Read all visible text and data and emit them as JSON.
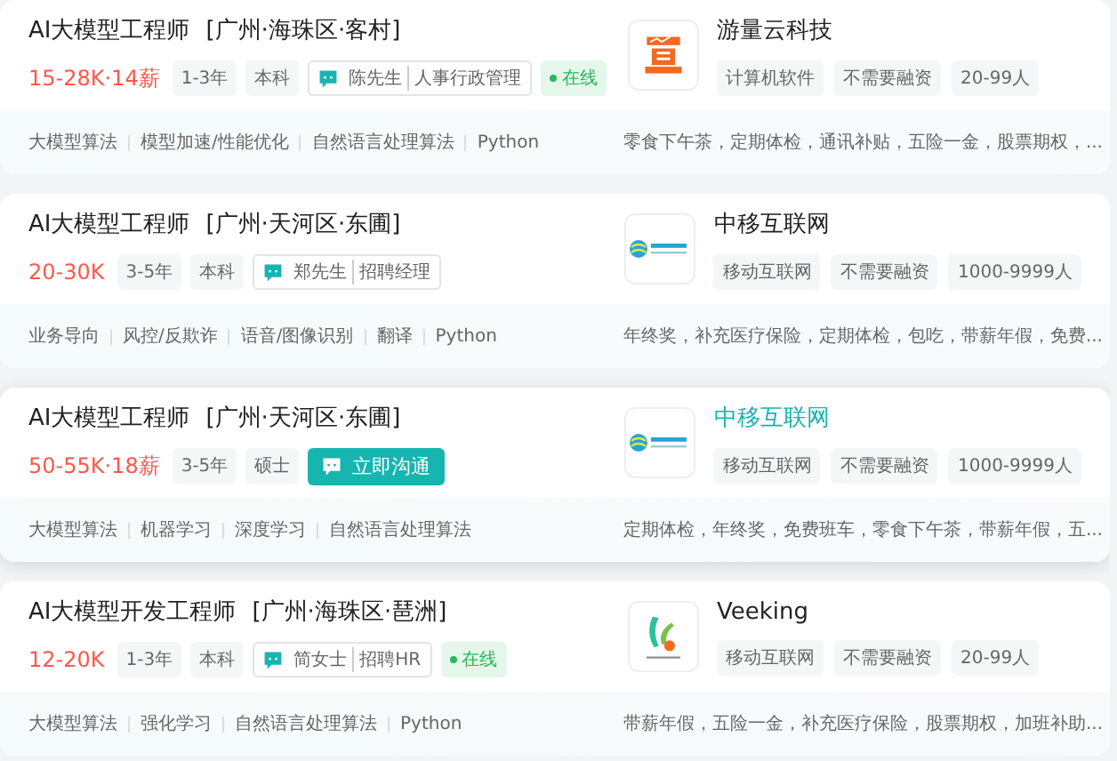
{
  "jobs": [
    {
      "title": "AI大模型工程师",
      "location": "[广州·海珠区·客村]",
      "salary": "15-28K·14薪",
      "tags": [
        "1-3年",
        "本科"
      ],
      "recruiter": {
        "kind": "contact",
        "name": "陈先生",
        "role": "人事行政管理"
      },
      "online": true,
      "online_label": "在线",
      "hovered": false,
      "company": {
        "kind": "bars",
        "name": "游量云科技",
        "tags": [
          "计算机软件",
          "不需要融资",
          "20-99人"
        ]
      },
      "skills": [
        "大模型算法",
        "模型加速/性能优化",
        "自然语言处理算法",
        "Python"
      ],
      "benefits": "零食下午茶，定期体检，通讯补贴，五险一金，股票期权，..."
    },
    {
      "title": "AI大模型工程师",
      "location": "[广州·天河区·东圃]",
      "salary": "20-30K",
      "tags": [
        "3-5年",
        "本科"
      ],
      "recruiter": {
        "kind": "contact",
        "name": "郑先生",
        "role": "招聘经理"
      },
      "online": false,
      "hovered": false,
      "company": {
        "kind": "globe",
        "name": "中移互联网",
        "tags": [
          "移动互联网",
          "不需要融资",
          "1000-9999人"
        ]
      },
      "skills": [
        "业务导向",
        "风控/反欺诈",
        "语音/图像识别",
        "翻译",
        "Python"
      ],
      "benefits": "年终奖，补充医疗保险，定期体检，包吃，带薪年假，免费..."
    },
    {
      "title": "AI大模型工程师",
      "location": "[广州·天河区·东圃]",
      "salary": "50-55K·18薪",
      "tags": [
        "3-5年",
        "硕士"
      ],
      "recruiter": {
        "kind": "chat",
        "label": "立即沟通"
      },
      "online": false,
      "hovered": true,
      "company": {
        "kind": "globe",
        "name": "中移互联网",
        "tags": [
          "移动互联网",
          "不需要融资",
          "1000-9999人"
        ]
      },
      "skills": [
        "大模型算法",
        "机器学习",
        "深度学习",
        "自然语言处理算法"
      ],
      "benefits": "定期体检，年终奖，免费班车，零食下午茶，带薪年假，五..."
    },
    {
      "title": "AI大模型开发工程师",
      "location": "[广州·海珠区·琶洲]",
      "salary": "12-20K",
      "tags": [
        "1-3年",
        "本科"
      ],
      "recruiter": {
        "kind": "contact",
        "name": "简女士",
        "role": "招聘HR"
      },
      "online": true,
      "online_label": "在线",
      "hovered": false,
      "company": {
        "kind": "leaf",
        "name": "Veeking",
        "tags": [
          "移动互联网",
          "不需要融资",
          "20-99人"
        ]
      },
      "skills": [
        "大模型算法",
        "强化学习",
        "自然语言处理算法",
        "Python"
      ],
      "benefits": "带薪年假，五险一金，补充医疗保险，股票期权，加班补助..."
    }
  ]
}
